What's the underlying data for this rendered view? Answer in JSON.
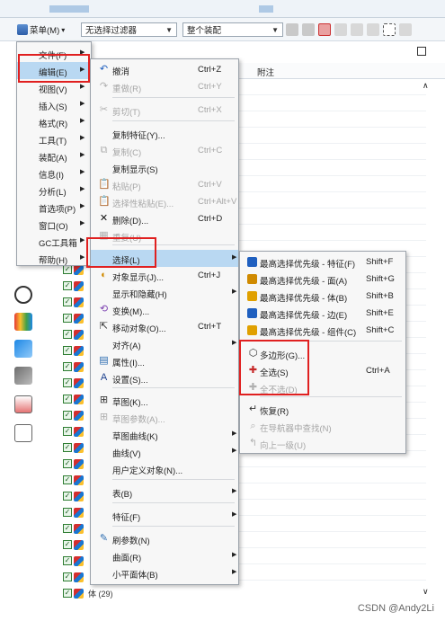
{
  "toolbar": {
    "menu_label": "菜单(M)",
    "filter_value": "无选择过滤器",
    "assembly_value": "整个装配"
  },
  "menu_main": [
    {
      "label": "文件(F)",
      "arrow": true
    },
    {
      "label": "编辑(E)",
      "arrow": true,
      "active": true
    },
    {
      "label": "视图(V)",
      "arrow": true
    },
    {
      "label": "插入(S)",
      "arrow": true
    },
    {
      "label": "格式(R)",
      "arrow": true
    },
    {
      "label": "工具(T)",
      "arrow": true
    },
    {
      "label": "装配(A)",
      "arrow": true
    },
    {
      "label": "信息(I)",
      "arrow": true
    },
    {
      "label": "分析(L)",
      "arrow": true
    },
    {
      "label": "首选项(P)",
      "arrow": true
    },
    {
      "label": "窗口(O)",
      "arrow": true
    },
    {
      "label": "GC工具箱",
      "arrow": true
    },
    {
      "label": "帮助(H)",
      "arrow": true
    }
  ],
  "menu_edit": [
    {
      "label": "撤消",
      "shortcut": "Ctrl+Z",
      "icon": "undo-icon",
      "glyph": "↶",
      "color": "#1f5fbf"
    },
    {
      "label": "重做(R)",
      "shortcut": "Ctrl+Y",
      "icon": "redo-icon",
      "glyph": "↷",
      "disabled": true
    },
    {
      "label": "剪切(T)",
      "shortcut": "Ctrl+X",
      "icon": "cut-icon",
      "glyph": "✂",
      "disabled": true
    },
    {
      "label": "复制特征(Y)...",
      "shortcut": ""
    },
    {
      "label": "复制(C)",
      "shortcut": "Ctrl+C",
      "icon": "copy-icon",
      "glyph": "⧉",
      "disabled": true
    },
    {
      "label": "复制显示(S)",
      "shortcut": ""
    },
    {
      "label": "粘贴(P)",
      "shortcut": "Ctrl+V",
      "icon": "paste-icon",
      "glyph": "📋",
      "disabled": true
    },
    {
      "label": "选择性粘贴(E)...",
      "shortcut": "Ctrl+Alt+V",
      "icon": "paste-special-icon",
      "glyph": "📋",
      "disabled": true
    },
    {
      "label": "删除(D)...",
      "shortcut": "Ctrl+D",
      "icon": "delete-icon",
      "glyph": "✕",
      "color": "#111"
    },
    {
      "label": "重复(U)",
      "shortcut": "",
      "icon": "repeat-icon",
      "glyph": "▦",
      "disabled": true
    },
    {
      "label": "选择(L)",
      "arrow": true,
      "active": true
    },
    {
      "label": "对象显示(J)...",
      "shortcut": "Ctrl+J",
      "icon": "object-display-icon",
      "glyph": "◐",
      "color": "#d08a00"
    },
    {
      "label": "显示和隐藏(H)",
      "arrow": true
    },
    {
      "label": "变换(M)...",
      "shortcut": "",
      "icon": "transform-icon",
      "glyph": "⟲",
      "color": "#7b3fb0"
    },
    {
      "label": "移动对象(O)...",
      "shortcut": "Ctrl+T",
      "icon": "move-object-icon",
      "glyph": "⇱",
      "color": "#333"
    },
    {
      "label": "对齐(A)",
      "arrow": true
    },
    {
      "label": "属性(I)...",
      "shortcut": "",
      "icon": "properties-icon",
      "glyph": "▤",
      "color": "#2b6cb0"
    },
    {
      "label": "设置(S)...",
      "shortcut": "",
      "icon": "settings-icon",
      "glyph": "A",
      "color": "#1a3e8c"
    },
    {
      "label": "草图(K)...",
      "shortcut": "",
      "icon": "sketch-icon",
      "glyph": "⊞",
      "color": "#333"
    },
    {
      "label": "草图参数(A)...",
      "shortcut": "",
      "icon": "sketch-params-icon",
      "glyph": "⊞",
      "disabled": true
    },
    {
      "label": "草图曲线(K)",
      "arrow": true
    },
    {
      "label": "曲线(V)",
      "arrow": true
    },
    {
      "label": "用户定义对象(N)...",
      "shortcut": ""
    },
    {
      "label": "表(B)",
      "arrow": true
    },
    {
      "label": "特征(F)",
      "arrow": true
    },
    {
      "label": "刷参数(N)",
      "shortcut": "",
      "icon": "brush-params-icon",
      "glyph": "✎",
      "color": "#2b6cb0"
    },
    {
      "label": "曲面(R)",
      "arrow": true
    },
    {
      "label": "小平面体(B)",
      "arrow": true
    }
  ],
  "menu_select": [
    {
      "label": "最高选择优先级 - 特征(F)",
      "shortcut": "Shift+F",
      "icon": "priority-feature-icon",
      "color": "#1f5fbf"
    },
    {
      "label": "最高选择优先级 - 面(A)",
      "shortcut": "Shift+G",
      "icon": "priority-face-icon",
      "color": "#d08a00"
    },
    {
      "label": "最高选择优先级 - 体(B)",
      "shortcut": "Shift+B",
      "icon": "priority-body-icon",
      "color": "#e0a000"
    },
    {
      "label": "最高选择优先级 - 边(E)",
      "shortcut": "Shift+E",
      "icon": "priority-edge-icon",
      "color": "#1f5fbf"
    },
    {
      "label": "最高选择优先级 - 组件(C)",
      "shortcut": "Shift+C",
      "icon": "priority-component-icon",
      "color": "#e0a000"
    },
    {
      "label": "多边形(G)...",
      "shortcut": "",
      "icon": "polygon-icon",
      "glyph": "⬡"
    },
    {
      "label": "全选(S)",
      "shortcut": "Ctrl+A",
      "icon": "select-all-icon",
      "glyph": "✚",
      "color": "#c62828"
    },
    {
      "label": "全不选(D)",
      "shortcut": "",
      "icon": "deselect-all-icon",
      "glyph": "✚",
      "disabled": true
    },
    {
      "label": "恢复(R)",
      "shortcut": "",
      "icon": "restore-icon",
      "glyph": "↵",
      "color": "#333"
    },
    {
      "label": "在导航器中查找(N)",
      "shortcut": "",
      "icon": "find-navigator-icon",
      "glyph": "⌕",
      "disabled": true
    },
    {
      "label": "向上一级(U)",
      "shortcut": "",
      "icon": "up-level-icon",
      "glyph": "↰",
      "disabled": true
    }
  ],
  "background": {
    "column_header": "附注",
    "tree_last_row": "体 (29)"
  },
  "watermark": "CSDN @Andy2Li"
}
